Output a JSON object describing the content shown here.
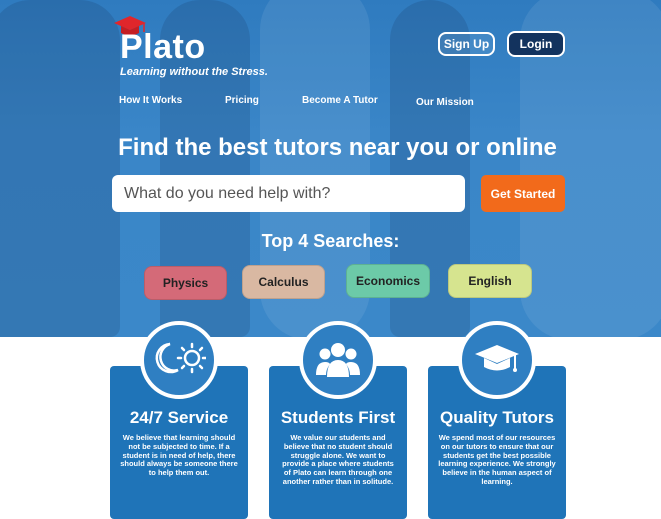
{
  "brand": {
    "name": "Plato",
    "tagline": "Learning without the Stress."
  },
  "header": {
    "signup_label": "Sign Up",
    "login_label": "Login"
  },
  "nav": {
    "items": [
      {
        "label": "How It Works"
      },
      {
        "label": "Pricing"
      },
      {
        "label": "Become A Tutor"
      },
      {
        "label": "Our Mission"
      }
    ]
  },
  "hero": {
    "headline": "Find the best tutors near you or online",
    "search_placeholder": "What do you need help with?",
    "cta_label": "Get Started"
  },
  "top_searches": {
    "title": "Top 4 Searches:",
    "items": [
      {
        "label": "Physics",
        "color": "#d46a78"
      },
      {
        "label": "Calculus",
        "color": "#d9b8a2"
      },
      {
        "label": "Economics",
        "color": "#6ccaa8"
      },
      {
        "label": "English",
        "color": "#d6e48f"
      }
    ]
  },
  "features": [
    {
      "icon": "moon-sun-icon",
      "title": "24/7 Service",
      "text": "We believe that learning should not be subjected to time. If a student is in need of help, there should always be someone there to help them out."
    },
    {
      "icon": "students-icon",
      "title": "Students First",
      "text": "We value our students and believe that no student should struggle alone. We want to provide a place where students of Plato can learn through one another rather than in solitude."
    },
    {
      "icon": "graduation-cap-icon",
      "title": "Quality Tutors",
      "text": "We spend most of our resources on our tutors to ensure that our students get the best possible learning experience. We strongly believe in the human aspect of learning."
    }
  ],
  "colors": {
    "brand_blue": "#1f74b8",
    "accent_orange": "#f26a1b",
    "dark_navy": "#13335e"
  }
}
